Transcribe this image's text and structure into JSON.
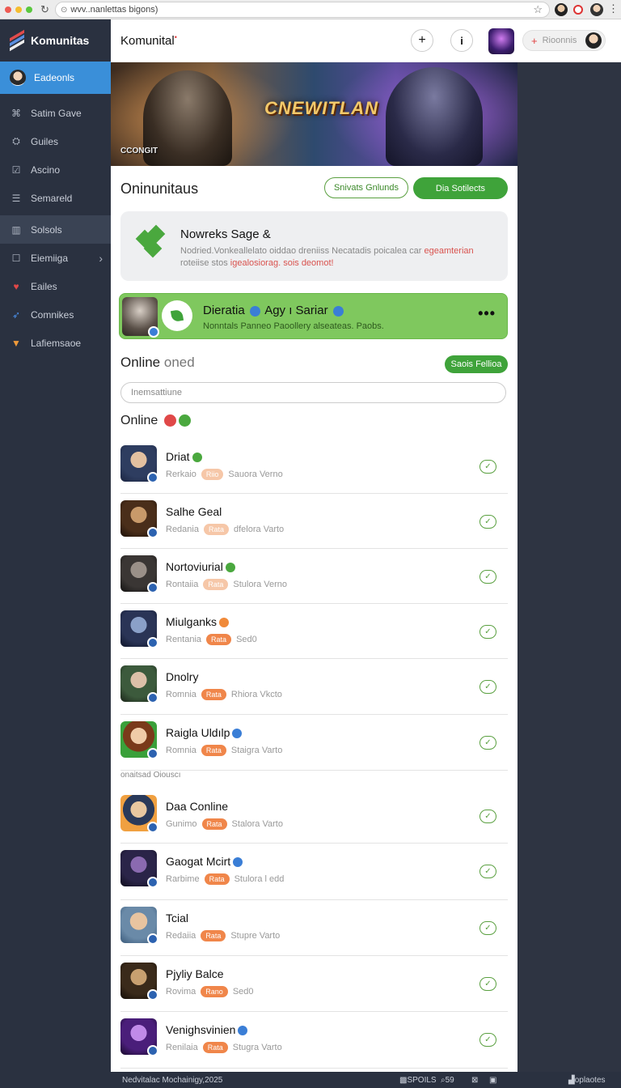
{
  "browser": {
    "url": "wvv..nanlettas bigons)",
    "controls": [
      "close",
      "minimize",
      "maximize"
    ],
    "colors": {
      "close": "#ee5a52",
      "minimize": "#f5bd30",
      "maximize": "#5ac83e"
    }
  },
  "sidebar": {
    "brand": "Komunitas",
    "active": "Eadeonls",
    "items": [
      {
        "label": "Satim Gave",
        "icon": "gamepad-icon"
      },
      {
        "label": "Guiles",
        "icon": "guide-icon"
      },
      {
        "label": "Ascino",
        "icon": "bookmark-icon"
      },
      {
        "label": "Semareld",
        "icon": "list-icon"
      },
      {
        "label": "Solsols",
        "icon": "book-icon"
      },
      {
        "label": "Eiemiiga",
        "icon": "square-icon"
      },
      {
        "label": "Eailes",
        "icon": "heart-icon"
      },
      {
        "label": "Comnikes",
        "icon": "rocket-icon"
      },
      {
        "label": "Lafiemsaoe",
        "icon": "shield-icon"
      }
    ]
  },
  "header": {
    "title": "Komunital",
    "add_icon": "+",
    "info_icon": "i",
    "user_pill_label": "Rioonnis"
  },
  "banner": {
    "title": "CNEWITLAN",
    "small_text": "CCONGIT"
  },
  "community": {
    "title": "Oninunitaus",
    "outline_button": "Snivats Gnlunds",
    "primary_button": "Dia Sotilects"
  },
  "info_card": {
    "title": "Nowreks Sage &",
    "desc_line1": "Nodried.Vonkeallelato oiddao dreniiss Necatadis poicalea car",
    "desc_line1_red": "egeamterian",
    "desc_line2": "roteiise stos",
    "desc_line2_red": "igealosiorag. sois deomot!"
  },
  "featured": {
    "title": "Dieratia",
    "title2": "Agy ı Sariar",
    "desc": "Nonntals Panneo Paoollery alseateas. Paobs.",
    "more": "•••"
  },
  "online_section": {
    "title": "Online",
    "title_light": "oned",
    "button": "Saois Fellioa",
    "search_placeholder": "Inemsattiune",
    "list_title": "Online",
    "subheader": "onaitsad Oiouscı"
  },
  "members": [
    {
      "name": "Driat",
      "meta1": "Rerkaio",
      "tag": "Riio",
      "meta2": "Sauora Verno",
      "verified": "green",
      "tag_faint": true,
      "avatar": "a1"
    },
    {
      "name": "Salhe Geal",
      "meta1": "Redania",
      "tag": "Rata",
      "meta2": "dfelora Varto",
      "verified": "",
      "tag_faint": true,
      "avatar": "a2"
    },
    {
      "name": "Nortoviurial",
      "meta1": "Rontaiia",
      "tag": "Rata",
      "meta2": "Stulora Verno",
      "verified": "green",
      "tag_faint": true,
      "avatar": "a3"
    },
    {
      "name": "Miulganks",
      "meta1": "Rentania",
      "tag": "Rata",
      "meta2": "Sed0",
      "verified": "orange",
      "tag_faint": false,
      "avatar": "a4"
    },
    {
      "name": "Dnolry",
      "meta1": "Romnia",
      "tag": "Rata",
      "meta2": "Rhiora Vkcto",
      "verified": "",
      "tag_faint": false,
      "avatar": "a5"
    },
    {
      "name": "Raigla Uldılp",
      "meta1": "Romnia",
      "tag": "Rata",
      "meta2": "Staigra Varto",
      "verified": "blue",
      "tag_faint": false,
      "avatar": "a6"
    },
    {
      "name": "Daa Conline",
      "meta1": "Gunimo",
      "tag": "Rata",
      "meta2": "Stalora Varto",
      "verified": "",
      "tag_faint": false,
      "avatar": "a7"
    },
    {
      "name": "Gaogat Mcirt",
      "meta1": "Rarbime",
      "tag": "Rata",
      "meta2": "Stulora l edd",
      "verified": "blue",
      "tag_faint": false,
      "avatar": "a8"
    },
    {
      "name": "Tcial",
      "meta1": "Redaiia",
      "tag": "Rata",
      "meta2": "Stupre Varto",
      "verified": "",
      "tag_faint": false,
      "avatar": "a9"
    },
    {
      "name": "Pjyliy Balce",
      "meta1": "Rovima",
      "tag": "Rano",
      "meta2": "Sed0",
      "verified": "",
      "tag_faint": false,
      "avatar": "a10"
    },
    {
      "name": "Venighsvinien",
      "meta1": "Renilaia",
      "tag": "Rata",
      "meta2": "Stugra Varto",
      "verified": "blue",
      "tag_faint": false,
      "avatar": "a11"
    }
  ],
  "statusbar": {
    "left": "Nedvitalac Mochainigy,2025",
    "mid1": "SPOILS",
    "mid2": "59",
    "right": "oplaotes"
  }
}
